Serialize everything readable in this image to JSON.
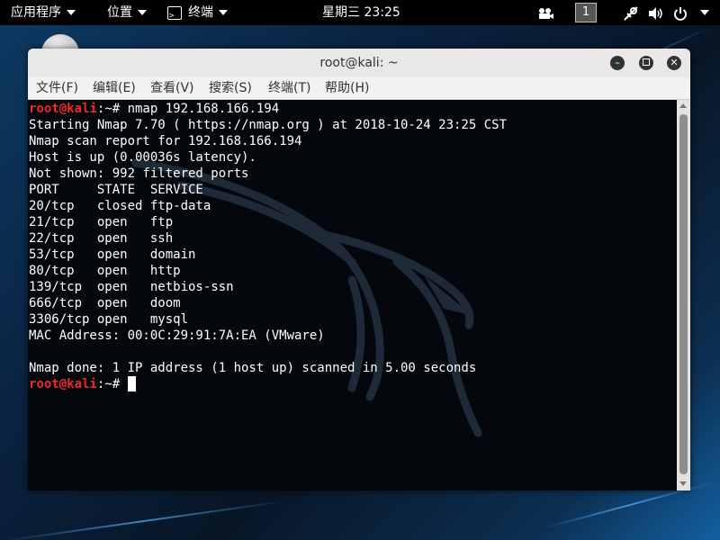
{
  "topbar": {
    "applications_menu": "应用程序",
    "places_menu": "位置",
    "active_app": "终端",
    "clock": "星期三 23:25",
    "workspace_number": "1"
  },
  "window": {
    "title": "root@kali: ~",
    "menu": [
      "文件(F)",
      "编辑(E)",
      "查看(V)",
      "搜索(S)",
      "终端(T)",
      "帮助(H)"
    ]
  },
  "terminal": {
    "prompt_user": "root@kali",
    "prompt_rest": ":~# ",
    "command": "nmap 192.168.166.194",
    "output": [
      "Starting Nmap 7.70 ( https://nmap.org ) at 2018-10-24 23:25 CST",
      "Nmap scan report for 192.168.166.194",
      "Host is up (0.00036s latency).",
      "Not shown: 992 filtered ports",
      "PORT     STATE  SERVICE",
      "20/tcp   closed ftp-data",
      "21/tcp   open   ftp",
      "22/tcp   open   ssh",
      "53/tcp   open   domain",
      "80/tcp   open   http",
      "139/tcp  open   netbios-ssn",
      "666/tcp  open   doom",
      "3306/tcp open   mysql",
      "MAC Address: 00:0C:29:91:7A:EA (VMware)",
      "",
      "Nmap done: 1 IP address (1 host up) scanned in 5.00 seconds"
    ]
  },
  "colors": {
    "prompt_user": "#ef2929",
    "terminal_bg": "#04070c",
    "terminal_fg": "#ffffff"
  }
}
